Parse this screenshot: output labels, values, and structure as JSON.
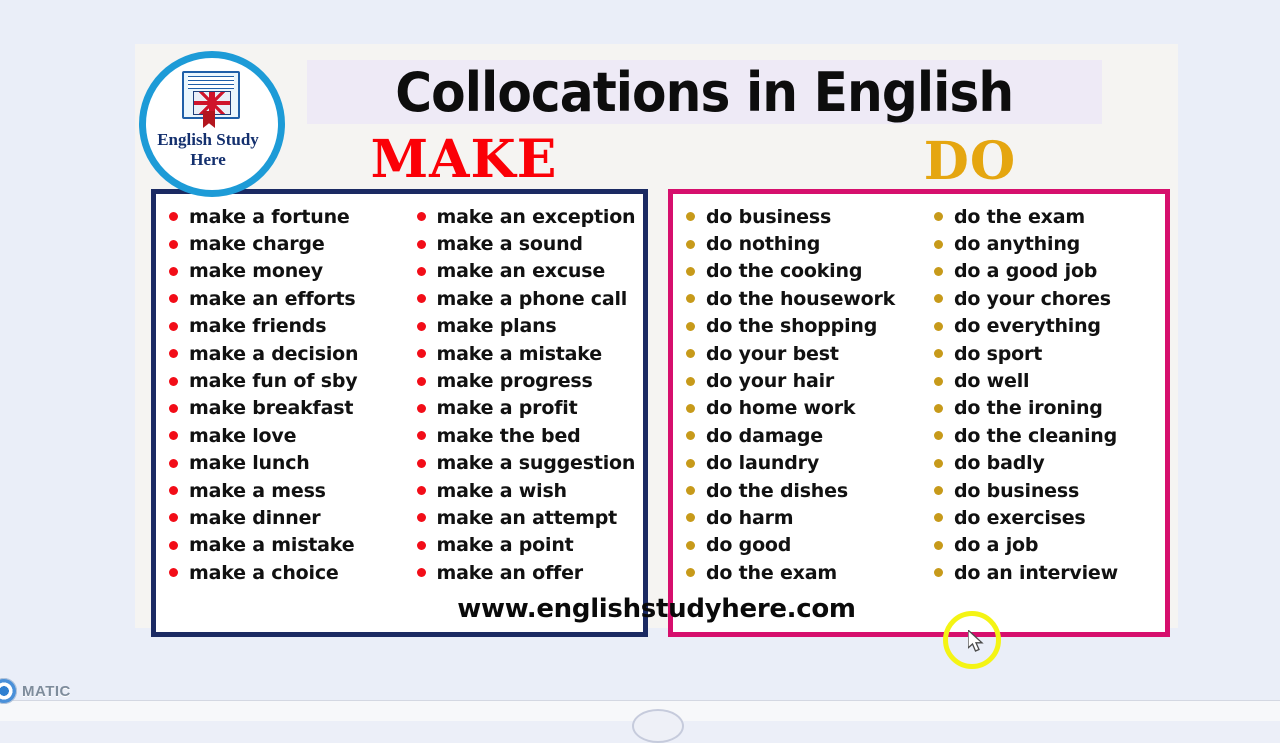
{
  "watermark": {
    "label": "MATIC",
    "icon": "record-ring-icon"
  },
  "logo": {
    "line1": "English Study",
    "line2": "Here",
    "ring_color": "#1d9bd7",
    "text_color": "#14306e"
  },
  "header": {
    "title": "Collocations in English",
    "banner_color": "#eeeaf6"
  },
  "sections": [
    {
      "heading": "MAKE",
      "heading_color": "#fb0007",
      "border_color": "#1b2a63",
      "bullet_color": "#f20d18",
      "columns": [
        [
          "make a fortune",
          "make charge",
          "make money",
          "make an efforts",
          "make friends",
          "make a decision",
          "make fun of sby",
          "make breakfast",
          "make love",
          "make lunch",
          "make a mess",
          "make dinner",
          "make a mistake",
          "make a choice"
        ],
        [
          "make an exception",
          "make a sound",
          "make an excuse",
          "make a phone call",
          "make plans",
          "make a mistake",
          "make progress",
          "make a profit",
          "make the bed",
          "make a suggestion",
          "make a wish",
          "make an attempt",
          "make a point",
          "make an offer"
        ]
      ]
    },
    {
      "heading": "DO",
      "heading_color": "#e5a610",
      "border_color": "#d60f6d",
      "bullet_color": "#c79a1a",
      "columns": [
        [
          "do business",
          "do nothing",
          "do the cooking",
          "do the housework",
          "do the shopping",
          "do your best",
          "do your hair",
          "do home work",
          "do damage",
          "do laundry",
          "do the dishes",
          "do harm",
          "do good",
          "do the exam"
        ],
        [
          "do the exam",
          "do anything",
          "do a good job",
          "do your chores",
          "do everything",
          "do sport",
          "do well",
          "do the ironing",
          "do the cleaning",
          "do badly",
          "do business",
          "do exercises",
          "do a job",
          "do an interview"
        ]
      ]
    }
  ],
  "footer": {
    "url": "www.englishstudyhere.com"
  }
}
